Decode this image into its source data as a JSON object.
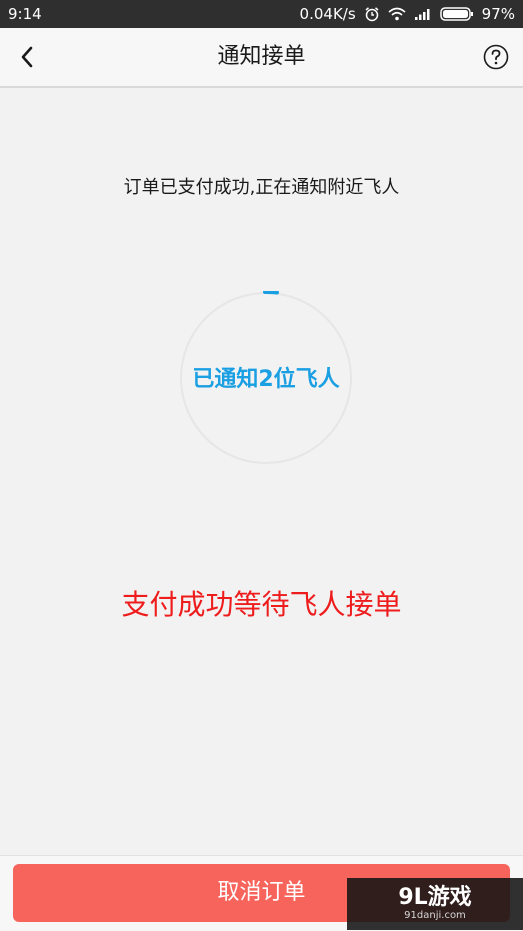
{
  "status_bar": {
    "time": "9:14",
    "network_speed": "0.04K/s",
    "battery": "97%",
    "icons": [
      "alarm-icon",
      "wifi-icon",
      "signal-icon",
      "battery-icon"
    ]
  },
  "nav": {
    "title": "通知接单",
    "back_icon": "back-chevron-icon",
    "help_icon": "help-circle-icon"
  },
  "main": {
    "notice": "订单已支付成功,正在通知附近飞人",
    "progress_label": "已通知2位飞人",
    "status_message": "支付成功等待飞人接单"
  },
  "footer": {
    "cancel_label": "取消订单"
  },
  "watermark": {
    "logo": "9L游戏",
    "url": "91danji.com"
  },
  "colors": {
    "accent_blue": "#1a9fe3",
    "alert_red": "#ee1c1c",
    "button_red": "#f7645c"
  }
}
